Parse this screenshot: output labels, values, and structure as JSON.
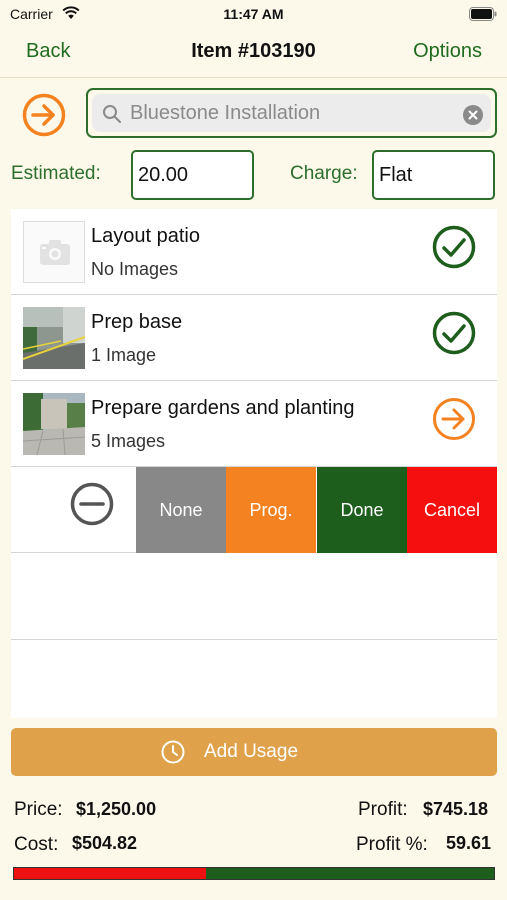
{
  "status_bar": {
    "carrier": "Carrier",
    "time": "11:47 AM"
  },
  "nav": {
    "back_label": "Back",
    "title": "Item #103190",
    "options_label": "Options"
  },
  "search": {
    "value": "",
    "placeholder": "Bluestone Installation"
  },
  "estimate": {
    "label": "Estimated:",
    "value": "20.00"
  },
  "charge": {
    "label": "Charge:",
    "value": "Flat"
  },
  "tasks": [
    {
      "title": "Layout patio",
      "subtitle": "No Images",
      "status": "done",
      "status_icon": "checkmark-circle-icon"
    },
    {
      "title": "Prep base",
      "subtitle": "1 Image",
      "status": "done",
      "status_icon": "checkmark-circle-icon"
    },
    {
      "title": "Prepare gardens and planting",
      "subtitle": "5 Images",
      "status": "progress",
      "status_icon": "arrow-circle-icon"
    }
  ],
  "swipe_actions": [
    {
      "label": "None",
      "color": "#888888"
    },
    {
      "label": "Prog.",
      "color": "#f58220"
    },
    {
      "label": "Done",
      "color": "#1d5e1d"
    },
    {
      "label": "Cancel",
      "color": "#f50f0f"
    }
  ],
  "add_usage_label": "Add Usage",
  "totals": {
    "price_label": "Price:",
    "price_value": "$1,250.00",
    "cost_label": "Cost:",
    "cost_value": "$504.82",
    "profit_label": "Profit:",
    "profit_value": "$745.18",
    "profit_pct_label": "Profit %:",
    "profit_pct_value": "59.61",
    "cost_fraction": 0.4
  },
  "colors": {
    "accent_green": "#2c6e2c",
    "accent_orange": "#f58220",
    "background": "#fdf9ea",
    "usage_button": "#dfa24a"
  }
}
